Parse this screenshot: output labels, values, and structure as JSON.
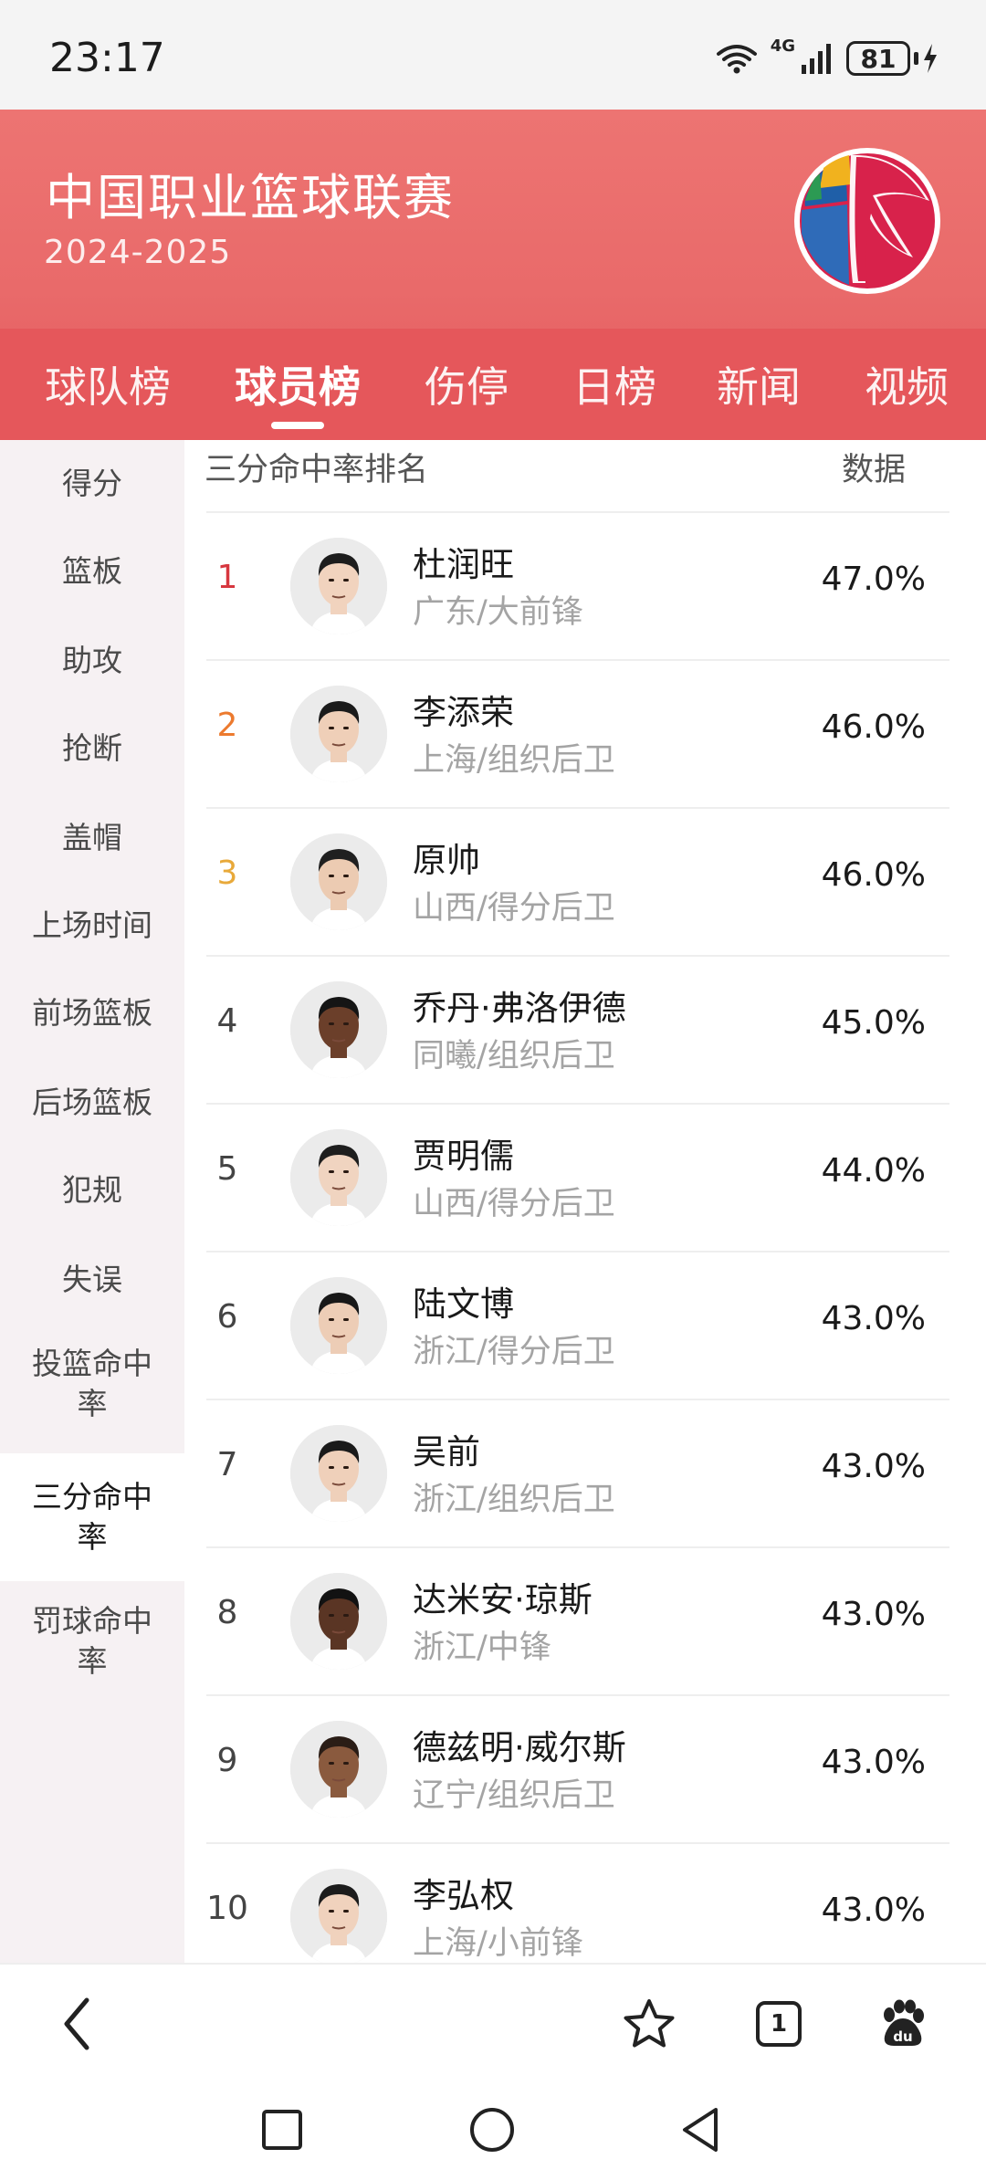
{
  "status": {
    "time": "23:17",
    "network": "4G",
    "battery": "81"
  },
  "header": {
    "title": "中国职业篮球联赛",
    "season": "2024-2025"
  },
  "tabs": [
    {
      "label": "球队榜",
      "active": false
    },
    {
      "label": "球员榜",
      "active": true
    },
    {
      "label": "伤停",
      "active": false
    },
    {
      "label": "日榜",
      "active": false
    },
    {
      "label": "新闻",
      "active": false
    },
    {
      "label": "视频",
      "active": false
    }
  ],
  "sidebar": [
    {
      "label": "得分",
      "active": false
    },
    {
      "label": "篮板",
      "active": false
    },
    {
      "label": "助攻",
      "active": false
    },
    {
      "label": "抢断",
      "active": false
    },
    {
      "label": "盖帽",
      "active": false
    },
    {
      "label": "上场时间",
      "active": false
    },
    {
      "label": "前场篮板",
      "active": false
    },
    {
      "label": "后场篮板",
      "active": false
    },
    {
      "label": "犯规",
      "active": false
    },
    {
      "label": "失误",
      "active": false
    },
    {
      "label": "投篮命中率",
      "active": false
    },
    {
      "label": "三分命中率",
      "active": true
    },
    {
      "label": "罚球命中率",
      "active": false
    }
  ],
  "list": {
    "title": "三分命中率排名",
    "data_label": "数据",
    "rows": [
      {
        "rank": "1",
        "name": "杜润旺",
        "team": "广东/大前锋",
        "value": "47.0%",
        "rank_color": "#d7373f",
        "skin": "#f1d3be",
        "hair": "#1d1d1d"
      },
      {
        "rank": "2",
        "name": "李添荣",
        "team": "上海/组织后卫",
        "value": "46.0%",
        "rank_color": "#ec7a2e",
        "skin": "#efcfb8",
        "hair": "#1b1b1b"
      },
      {
        "rank": "3",
        "name": "原帅",
        "team": "山西/得分后卫",
        "value": "46.0%",
        "rank_color": "#e8a93a",
        "skin": "#eccbb2",
        "hair": "#202020"
      },
      {
        "rank": "4",
        "name": "乔丹·弗洛伊德",
        "team": "同曦/组织后卫",
        "value": "45.0%",
        "rank_color": "#444444",
        "skin": "#6b3f2a",
        "hair": "#151515"
      },
      {
        "rank": "5",
        "name": "贾明儒",
        "team": "山西/得分后卫",
        "value": "44.0%",
        "rank_color": "#444444",
        "skin": "#f0d4c0",
        "hair": "#1e1e1e"
      },
      {
        "rank": "6",
        "name": "陆文博",
        "team": "浙江/得分后卫",
        "value": "43.0%",
        "rank_color": "#444444",
        "skin": "#edcdb6",
        "hair": "#181818"
      },
      {
        "rank": "7",
        "name": "吴前",
        "team": "浙江/组织后卫",
        "value": "43.0%",
        "rank_color": "#444444",
        "skin": "#efd0ba",
        "hair": "#1a1a1a"
      },
      {
        "rank": "8",
        "name": "达米安·琼斯",
        "team": "浙江/中锋",
        "value": "43.0%",
        "rank_color": "#444444",
        "skin": "#5a3524",
        "hair": "#121212"
      },
      {
        "rank": "9",
        "name": "德兹明·威尔斯",
        "team": "辽宁/组织后卫",
        "value": "43.0%",
        "rank_color": "#444444",
        "skin": "#8a5a3e",
        "hair": "#2a1d16"
      },
      {
        "rank": "10",
        "name": "李弘权",
        "team": "上海/小前锋",
        "value": "43.0%",
        "rank_color": "#444444",
        "skin": "#f0d2bd",
        "hair": "#1c1c1c"
      }
    ]
  },
  "browser": {
    "tab_count": "1"
  },
  "icons": {
    "back": "back-arrow-icon",
    "favorite": "star-icon",
    "tabs": "tabs-icon",
    "home": "baidu-paw-icon"
  },
  "colors": {
    "header_top": "#ed7472",
    "tab_bar": "#e5575b",
    "sidebar_bg": "#f6f1f3"
  }
}
